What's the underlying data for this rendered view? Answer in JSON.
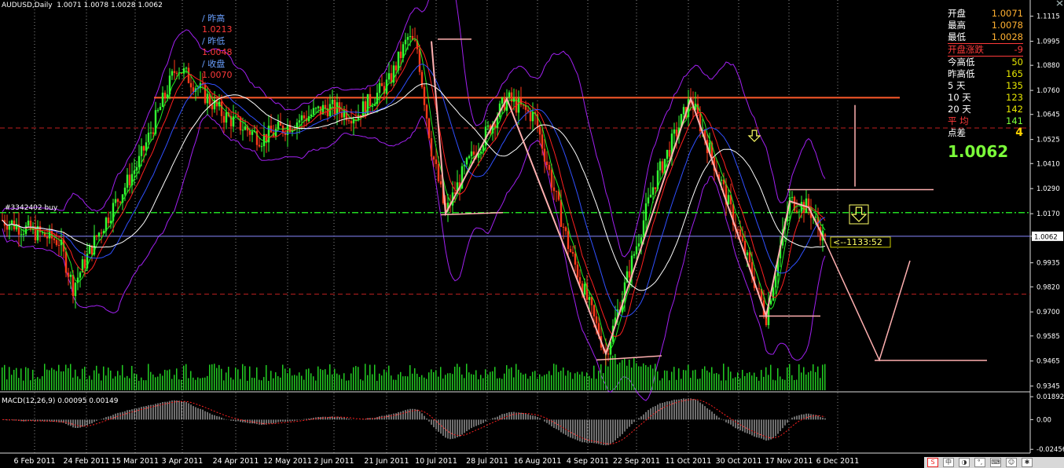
{
  "header": {
    "symbol_info": "AUDUSD,Daily  1.0071 1.0078 1.0028 1.0062",
    "prev": [
      {
        "label": "/ 昨高",
        "value": "1.0213"
      },
      {
        "label": "/ 昨低",
        "value": "1.0048"
      },
      {
        "label": "/ 收盘",
        "value": "1.0070"
      }
    ]
  },
  "panel": {
    "rows": [
      {
        "label": "开盘",
        "value": "1.0071",
        "label_color": "#ffffff",
        "value_color": "#ffb030"
      },
      {
        "label": "最高",
        "value": "1.0078",
        "label_color": "#ffffff",
        "value_color": "#ffb030"
      },
      {
        "label": "最低",
        "value": "1.0028",
        "label_color": "#ffffff",
        "value_color": "#ffb030"
      },
      {
        "label": "开盘涨跌",
        "value": "-9",
        "label_color": "#ff3a3a",
        "value_color": "#ff3a3a"
      },
      {
        "label": "今高低",
        "value": "50",
        "label_color": "#ffffff",
        "value_color": "#e6e600"
      },
      {
        "label": "昨高低",
        "value": "165",
        "label_color": "#ffffff",
        "value_color": "#e6e600"
      },
      {
        "label": "5  天",
        "value": "135",
        "label_color": "#ffffff",
        "value_color": "#e6e600"
      },
      {
        "label": "10 天",
        "value": "123",
        "label_color": "#ffffff",
        "value_color": "#e6e600"
      },
      {
        "label": "20 天",
        "value": "142",
        "label_color": "#ffffff",
        "value_color": "#e6e600"
      },
      {
        "label": "平  均",
        "value": "141",
        "label_color": "#ff3a3a",
        "value_color": "#7cff3a"
      },
      {
        "label": "点差",
        "value": "4",
        "label_color": "#ffffff",
        "value_color": "#ffd000"
      }
    ],
    "big_price": "1.0062"
  },
  "chart_data": {
    "type": "candlestick",
    "symbol": "AUDUSD",
    "timeframe": "Daily",
    "price_ticks": [
      "1.1115",
      "1.0995",
      "1.0880",
      "1.0760",
      "1.0645",
      "1.0525",
      "1.0410",
      "1.0290",
      "1.0170",
      "1.0062",
      "0.9935",
      "0.9820",
      "0.9700",
      "0.9585",
      "0.9465",
      "0.9345"
    ],
    "ylim": [
      0.9325,
      1.1155
    ],
    "current_price": "1.0062",
    "order_label": "#3342402 buy",
    "order_price": 1.0175,
    "countdown": "<--1133:52",
    "dates": [
      "6 Feb 2011",
      "24 Feb 2011",
      "15 Mar 2011",
      "3 Apr 2011",
      "24 Apr 2011",
      "12 May 2011",
      "2 Jun 2011",
      "21 Jun 2011",
      "10 Jul 2011",
      "28 Jul 2011",
      "16 Aug 2011",
      "4 Sep 2011",
      "22 Sep 2011",
      "11 Oct 2011",
      "30 Oct 2011",
      "17 Nov 2011",
      "6 Dec 2011"
    ],
    "waypoints": [
      [
        0,
        1.014
      ],
      [
        14,
        1.008
      ],
      [
        24,
        1.004
      ],
      [
        30,
        0.982
      ],
      [
        40,
        1.006
      ],
      [
        58,
        1.042
      ],
      [
        74,
        1.088
      ],
      [
        84,
        1.076
      ],
      [
        94,
        1.064
      ],
      [
        110,
        1.053
      ],
      [
        126,
        1.062
      ],
      [
        138,
        1.068
      ],
      [
        150,
        1.064
      ],
      [
        164,
        1.08
      ],
      [
        172,
        1.101
      ],
      [
        176,
        1.096
      ],
      [
        182,
        1.048
      ],
      [
        188,
        1.017
      ],
      [
        196,
        1.038
      ],
      [
        214,
        1.072
      ],
      [
        226,
        1.063
      ],
      [
        240,
        1.002
      ],
      [
        256,
        0.95
      ],
      [
        276,
        1.03
      ],
      [
        292,
        1.072
      ],
      [
        304,
        1.035
      ],
      [
        324,
        0.968
      ],
      [
        334,
        1.023
      ],
      [
        342,
        1.02
      ],
      [
        348,
        1.0062
      ]
    ],
    "horizontal_levels": [
      {
        "price": 1.0725,
        "color": "#ff5a2a",
        "style": "solid"
      },
      {
        "price": 1.058,
        "color": "#c02020",
        "style": "dash"
      },
      {
        "price": 0.9785,
        "color": "#c02020",
        "style": "dash"
      },
      {
        "price": 1.0175,
        "color": "#22dd22",
        "style": "dashdot"
      },
      {
        "price": 1.0062,
        "color": "#8888ff",
        "style": "solid"
      }
    ],
    "zigzag": [
      [
        182,
        1.0995
      ],
      [
        188,
        1.017
      ],
      [
        214,
        1.072
      ],
      [
        256,
        0.95
      ],
      [
        292,
        1.072
      ],
      [
        324,
        0.968
      ],
      [
        334,
        1.023
      ],
      [
        342,
        1.02
      ],
      [
        348,
        1.0062
      ]
    ],
    "projection": [
      [
        348,
        1.0062
      ],
      [
        372,
        0.947
      ],
      [
        385,
        0.9945
      ]
    ],
    "macd": {
      "label": "MACD(12,26,9) 0.00095 0.00149",
      "ticks": [
        "0.01892",
        "0.00",
        "-0.02456"
      ],
      "ylim": [
        -0.027,
        0.021
      ]
    }
  }
}
